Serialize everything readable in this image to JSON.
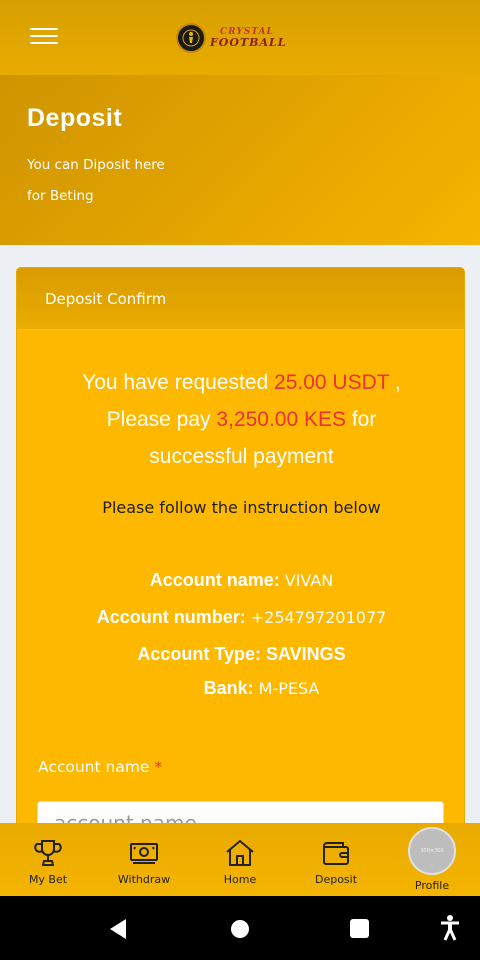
{
  "app": {
    "logo_line1": "CRYSTAL",
    "logo_line2": "FOOTBALL"
  },
  "hero": {
    "title": "Deposit",
    "subtitle_line1": "You can Diposit here",
    "subtitle_line2": "for Beting"
  },
  "card": {
    "header": "Deposit Confirm",
    "request": {
      "prefix": "You have requested ",
      "amount": "25.00 USDT",
      "sep": " ,",
      "pay_prefix": "Please pay ",
      "pay_amount": "3,250.00 KES",
      "pay_suffix": " for",
      "line3": "successful payment"
    },
    "instruction": "Please follow the instruction below",
    "account": {
      "name_label": "Account name:",
      "name_value": "VIVAN",
      "number_label": "Account number:",
      "number_value": "+254797201077",
      "type_label": "Account Type:",
      "type_value": "SAVINGS",
      "bank_label": "Bank:",
      "bank_value": "M-PESA"
    },
    "field": {
      "label": "Account name",
      "required_mark": "*",
      "placeholder": "account name"
    }
  },
  "bottom_nav": {
    "items": [
      {
        "label": "My Bet",
        "icon": "trophy-icon"
      },
      {
        "label": "Withdraw",
        "icon": "cash-icon"
      },
      {
        "label": "Home",
        "icon": "home-icon"
      },
      {
        "label": "Deposit",
        "icon": "wallet-icon"
      },
      {
        "label": "Profile",
        "icon": "avatar-placeholder",
        "avatar_text": "300×300"
      }
    ]
  },
  "colors": {
    "primary": "#ffb800",
    "header_dark": "#d79f00",
    "highlight_red": "#e8323c"
  }
}
